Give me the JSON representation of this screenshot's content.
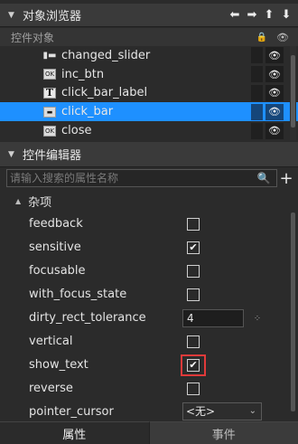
{
  "object_browser": {
    "title": "对象浏览器",
    "subheader_label": "控件对象",
    "tools": [
      "arrow-left-icon",
      "arrow-right-icon",
      "arrow-up-icon",
      "arrow-down-icon"
    ],
    "items": [
      {
        "name": "changed_slider",
        "icon": "slider-icon",
        "icon_text": "▮▬"
      },
      {
        "name": "inc_btn",
        "icon": "button-icon",
        "icon_text": "OK"
      },
      {
        "name": "click_bar_label",
        "icon": "label-icon",
        "icon_text": "T"
      },
      {
        "name": "click_bar",
        "icon": "progress-bar-icon",
        "icon_text": "▬"
      },
      {
        "name": "close",
        "icon": "button-icon",
        "icon_text": "OK"
      }
    ],
    "selected_index": 3
  },
  "widget_editor": {
    "title": "控件编辑器",
    "search_placeholder": "请输入搜索的属性名称",
    "group_name": "杂项",
    "properties": [
      {
        "name": "feedback",
        "type": "checkbox",
        "checked": false
      },
      {
        "name": "sensitive",
        "type": "checkbox",
        "checked": true
      },
      {
        "name": "focusable",
        "type": "checkbox",
        "checked": false
      },
      {
        "name": "with_focus_state",
        "type": "checkbox",
        "checked": false
      },
      {
        "name": "dirty_rect_tolerance",
        "type": "number",
        "value": "4"
      },
      {
        "name": "vertical",
        "type": "checkbox",
        "checked": false
      },
      {
        "name": "show_text",
        "type": "checkbox",
        "checked": true,
        "highlighted": true
      },
      {
        "name": "reverse",
        "type": "checkbox",
        "checked": false
      },
      {
        "name": "pointer_cursor",
        "type": "select",
        "value": "<无>"
      }
    ]
  },
  "tabs": [
    {
      "label": "属性",
      "active": true
    },
    {
      "label": "事件",
      "active": false
    }
  ],
  "colors": {
    "selection": "#1e90ff",
    "highlight_border": "#e03a3a",
    "panel_bg": "#2b2b2b",
    "header_bg": "#3a3a3a"
  }
}
